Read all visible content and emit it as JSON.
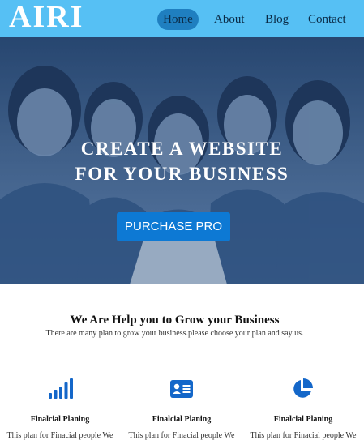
{
  "brand": {
    "logo": "AIRI"
  },
  "nav": {
    "items": [
      "Home",
      "About",
      "Blog",
      "Contact"
    ],
    "active": "Home"
  },
  "hero": {
    "title_line1": "CREATE A WEBSITE",
    "title_line2": "FOR YOUR BUSINESS",
    "cta_label": "PURCHASE PRO"
  },
  "services": {
    "title": "We Are Help you to Grow your Business",
    "subtitle": "There are many plan to grow your business.please choose your plan and say us.",
    "items": [
      {
        "icon": "signal-bars-icon",
        "title": "Finalcial Planing",
        "desc": "This plan for Finacial people We"
      },
      {
        "icon": "id-card-icon",
        "title": "Finalcial Planing",
        "desc": "This plan for Finacial people We"
      },
      {
        "icon": "pie-chart-icon",
        "title": "Finalcial Planing",
        "desc": "This plan for Finacial people We"
      }
    ]
  },
  "colors": {
    "nav_bg": "#56c0f4",
    "accent": "#0d79d4",
    "icon": "#1467c9"
  }
}
